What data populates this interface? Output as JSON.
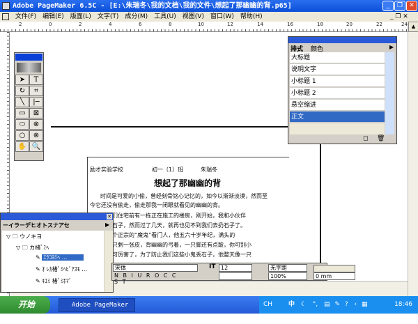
{
  "window": {
    "title": "Adobe PageMaker 6.5C - [E:\\朱瑞冬\\我的文档\\我的文件\\想起了那幽幽的背.p65]"
  },
  "menu": [
    "文件(F)",
    "编辑(E)",
    "版面(L)",
    "文字(T)",
    "成分(M)",
    "工具(U)",
    "视图(V)",
    "窗口(W)",
    "帮助(H)"
  ],
  "ruler_ticks": [
    "2",
    "0",
    "2",
    "4",
    "6",
    "8",
    "10",
    "12",
    "14",
    "16",
    "18",
    "20",
    "22",
    "24"
  ],
  "styles_palette": {
    "tabs": [
      "排式",
      "颜色"
    ],
    "items": [
      "大标题",
      "说明文字",
      "小标题 1",
      "小标题 2",
      "悬空缩进",
      "正文"
    ],
    "selected": "正文"
  },
  "document": {
    "header": [
      "励才实验学校",
      "初一（1）班",
      "朱瑞冬"
    ],
    "title": "想起了那幽幽的背",
    "lines": [
      "时间是可爱的小偷，曾经刻骨铭心记忆的，如今以渐渐淡漠，然而至",
      "今它还没有偷走，偷走那我一闭眼就看见的幽幽的背。",
      "那年，我们住宅前有一栋正在施工的楼房，刚开始，我和小伙伴",
      "工地上扔石子，然而过了几天，就再也见不到我们去扔石子了。",
      "是来了一个正宗的“魔鬼”看门人，他五六十岁年纪，满头的",
      "身干瘦的只剩一张皮，背幽幽的弓着，一只脚还有点跛，你可别小",
      "他的眼睛可厉害了，为了防止我们这些小鬼丢石子，他整天像一只"
    ]
  },
  "layers_palette": {
    "header": "ーイラーデヒオトスナアセ",
    "items": [
      "ウノキヨ",
      "カ楮ﾞﾐﾍ",
      "ｴﾗｺﾖﾐﾍ ...",
      "ｵ ﾚｶ楮ﾞﾐﾍﾋﾞｱｽﾓ ...",
      "ｷｴﾐ 楮ﾞﾐﾎﾏﾞ"
    ],
    "selected": "ｴﾗｺﾖﾐﾍ ..."
  },
  "control_palette": {
    "font": "宋体",
    "size": "12",
    "tracking": "无字距",
    "scale": "100%",
    "baseline": "0 mm",
    "style_buttons": [
      "N",
      "B",
      "I",
      "U",
      "R",
      "O",
      "C",
      "C",
      "S",
      "T"
    ]
  },
  "taskbar": {
    "start": "开始",
    "task": "Adobe PageMaker ...",
    "tray_ime": "CH",
    "tray_lang": "中",
    "clock": "18:46"
  },
  "colors": {
    "title_bar": "#0b4fd8",
    "selection": "#316ac5",
    "taskbar": "#2459d6",
    "start": "#2e8a2e"
  }
}
